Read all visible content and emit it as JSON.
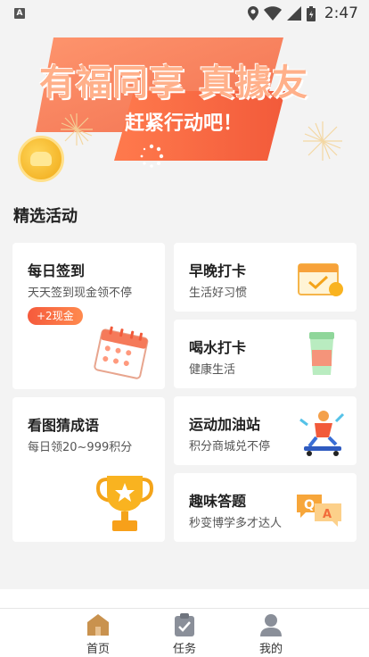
{
  "status_bar": {
    "time": "2:47",
    "notification_icon": "A"
  },
  "banner": {
    "headline": "有福同享 真據友",
    "subline": "赶紧行动吧！"
  },
  "section": {
    "title": "精选活动"
  },
  "cards": {
    "checkin": {
      "title": "每日签到",
      "subtitle": "天天签到现金领不停",
      "badge": "+2现金"
    },
    "guess": {
      "title": "看图猜成语",
      "subtitle": "每日领20~999积分"
    },
    "morning": {
      "title": "早晚打卡",
      "subtitle": "生活好习惯"
    },
    "water": {
      "title": "喝水打卡",
      "subtitle": "健康生活"
    },
    "sport": {
      "title": "运动加油站",
      "subtitle": "积分商城兑不停"
    },
    "quiz": {
      "title": "趣味答题",
      "subtitle": "秒变博学多才达人"
    }
  },
  "nav": {
    "home": "首页",
    "tasks": "任务",
    "mine": "我的"
  },
  "colors": {
    "accent": "#f2633f",
    "nav_home": "#c9924e"
  }
}
